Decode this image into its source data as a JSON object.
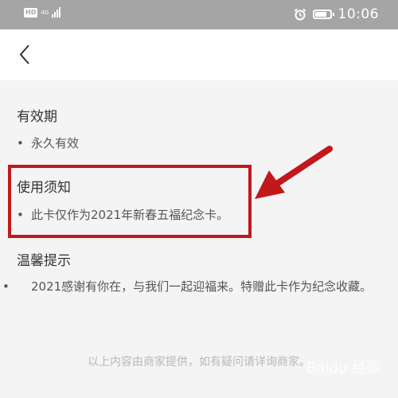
{
  "status_bar": {
    "hd_label": "HD",
    "network_label": "4G",
    "time": "10:06",
    "battery_level": 0.8
  },
  "header": {
    "back_icon": "chevron-left-icon"
  },
  "sections": [
    {
      "title": "有效期",
      "items": [
        "永久有效"
      ]
    },
    {
      "title": "使用须知",
      "items": [
        "此卡仅作为2021年新春五福纪念卡。"
      ]
    },
    {
      "title": "温馨提示",
      "items": [
        "2021感谢有你在，与我们一起迎福来。特赠此卡作为纪念收藏。"
      ]
    }
  ],
  "footer_note": "以上内容由商家提供，如有疑问请详询商家。",
  "bullet": "•",
  "watermark_text": "Baidu 经验",
  "colors": {
    "status_bar_bg": "#a5a5a5",
    "page_bg": "#f4f4f4",
    "header_bg": "#ffffff",
    "annotation_red": "#c2171b"
  }
}
